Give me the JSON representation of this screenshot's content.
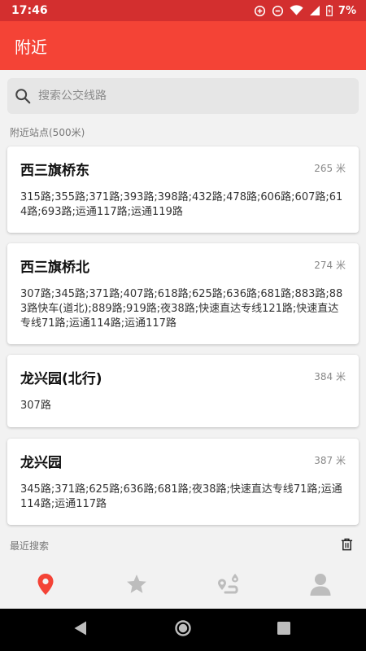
{
  "status_bar": {
    "time": "17:46",
    "battery": "7%"
  },
  "app_bar": {
    "title": "附近"
  },
  "search": {
    "placeholder": "搜索公交线路"
  },
  "nearby": {
    "label": "附近站点(500米)",
    "stops": [
      {
        "name": "西三旗桥东",
        "distance": "265 米",
        "routes": "315路;355路;371路;393路;398路;432路;478路;606路;607路;614路;693路;运通117路;运通119路"
      },
      {
        "name": "西三旗桥北",
        "distance": "274 米",
        "routes": "307路;345路;371路;407路;618路;625路;636路;681路;883路;883路快车(道北);889路;919路;夜38路;快速直达专线121路;快速直达专线71路;运通114路;运通117路"
      },
      {
        "name": "龙兴园(北行)",
        "distance": "384 米",
        "routes": "307路"
      },
      {
        "name": "龙兴园",
        "distance": "387 米",
        "routes": "345路;371路;625路;636路;681路;夜38路;快速直达专线71路;运通114路;运通117路"
      }
    ]
  },
  "recent": {
    "label": "最近搜索"
  },
  "colors": {
    "primary": "#f44336",
    "status_bar": "#d32f2f",
    "nav_active": "#f44336",
    "nav_inactive": "#bdbdbd"
  },
  "bottom_nav": [
    "location-pin-icon",
    "star-icon",
    "route-icon",
    "person-icon"
  ]
}
